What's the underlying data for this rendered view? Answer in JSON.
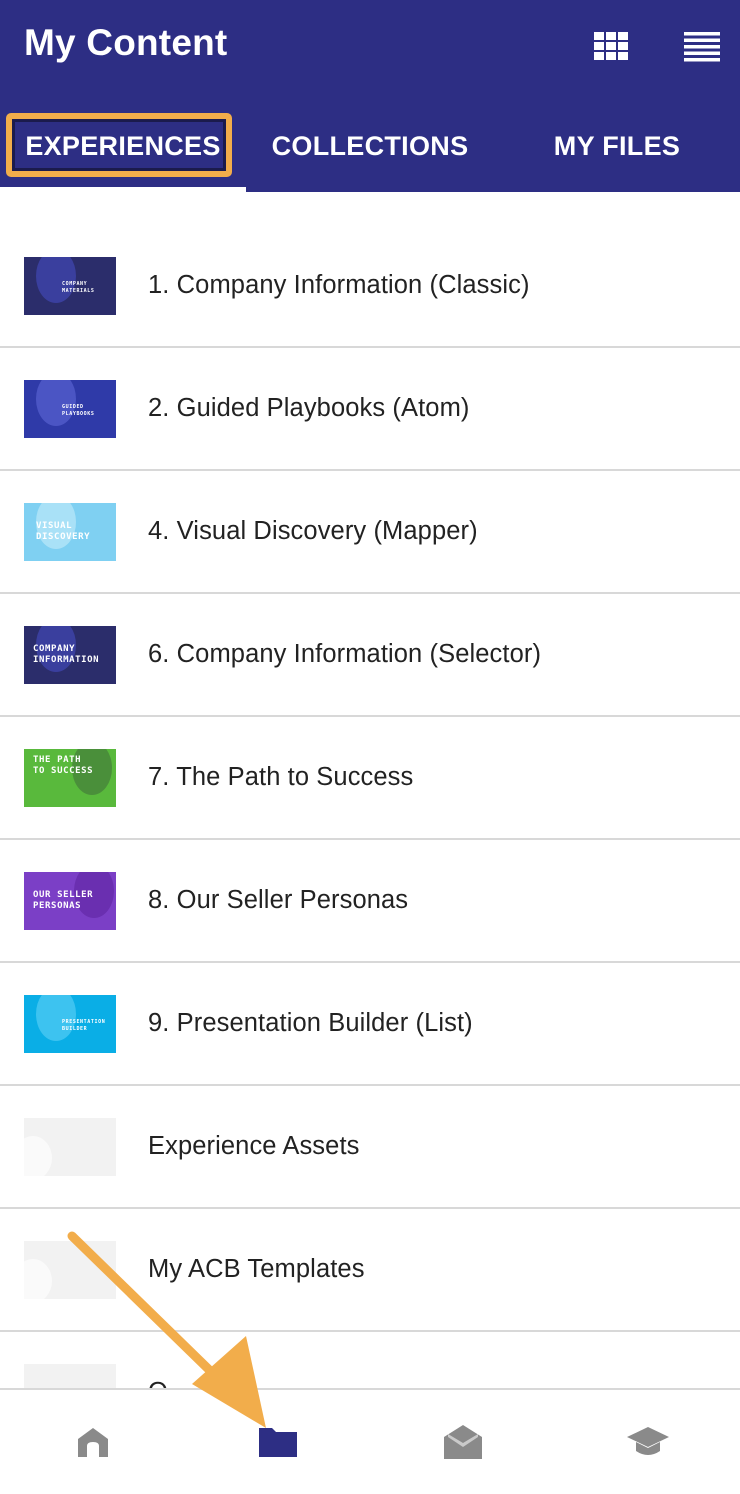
{
  "header": {
    "title": "My Content",
    "icons": [
      "grid-view-icon",
      "list-view-icon"
    ]
  },
  "tabs": [
    {
      "label": "EXPERIENCES",
      "active": true
    },
    {
      "label": "COLLECTIONS",
      "active": false
    },
    {
      "label": "MY FILES",
      "active": false
    }
  ],
  "items": [
    {
      "label": "1. Company Information (Classic)",
      "thumb_text": "COMPANY\nMATERIALS",
      "thumb_bg": "#2b2d6b"
    },
    {
      "label": "2. Guided Playbooks (Atom)",
      "thumb_text": "GUIDED\nPLAYBOOKS",
      "thumb_bg": "#2f3aa8"
    },
    {
      "label": "4. Visual Discovery (Mapper)",
      "thumb_text": "VISUAL\nDISCOVERY",
      "thumb_bg": "#7fd0f2"
    },
    {
      "label": "6. Company Information (Selector)",
      "thumb_text": "COMPANY\nINFORMATION",
      "thumb_bg": "#2b2d6b"
    },
    {
      "label": "7. The Path to Success",
      "thumb_text": "THE PATH\nTO SUCCESS",
      "thumb_bg": "#59b93c"
    },
    {
      "label": "8. Our Seller Personas",
      "thumb_text": "OUR SELLER\nPERSONAS",
      "thumb_bg": "#7b3fc6"
    },
    {
      "label": "9. Presentation Builder (List)",
      "thumb_text": "PRESENTATION\nBUILDER",
      "thumb_bg": "#0aaee6"
    },
    {
      "label": "Experience Assets",
      "thumb_text": "",
      "thumb_bg": "#f2f2f2"
    },
    {
      "label": "My ACB Templates",
      "thumb_text": "",
      "thumb_bg": "#f2f2f2"
    },
    {
      "label": "O",
      "thumb_text": "",
      "thumb_bg": "#f2f2f2"
    }
  ],
  "bottom_nav": [
    {
      "icon": "home-icon",
      "active": false
    },
    {
      "icon": "folder-icon",
      "active": true
    },
    {
      "icon": "open-mail-icon",
      "active": false
    },
    {
      "icon": "graduation-cap-icon",
      "active": false
    }
  ],
  "colors": {
    "brand": "#2d2e84",
    "annotation": "#f2ad4b",
    "inactive_icon": "#8a8a8a"
  }
}
